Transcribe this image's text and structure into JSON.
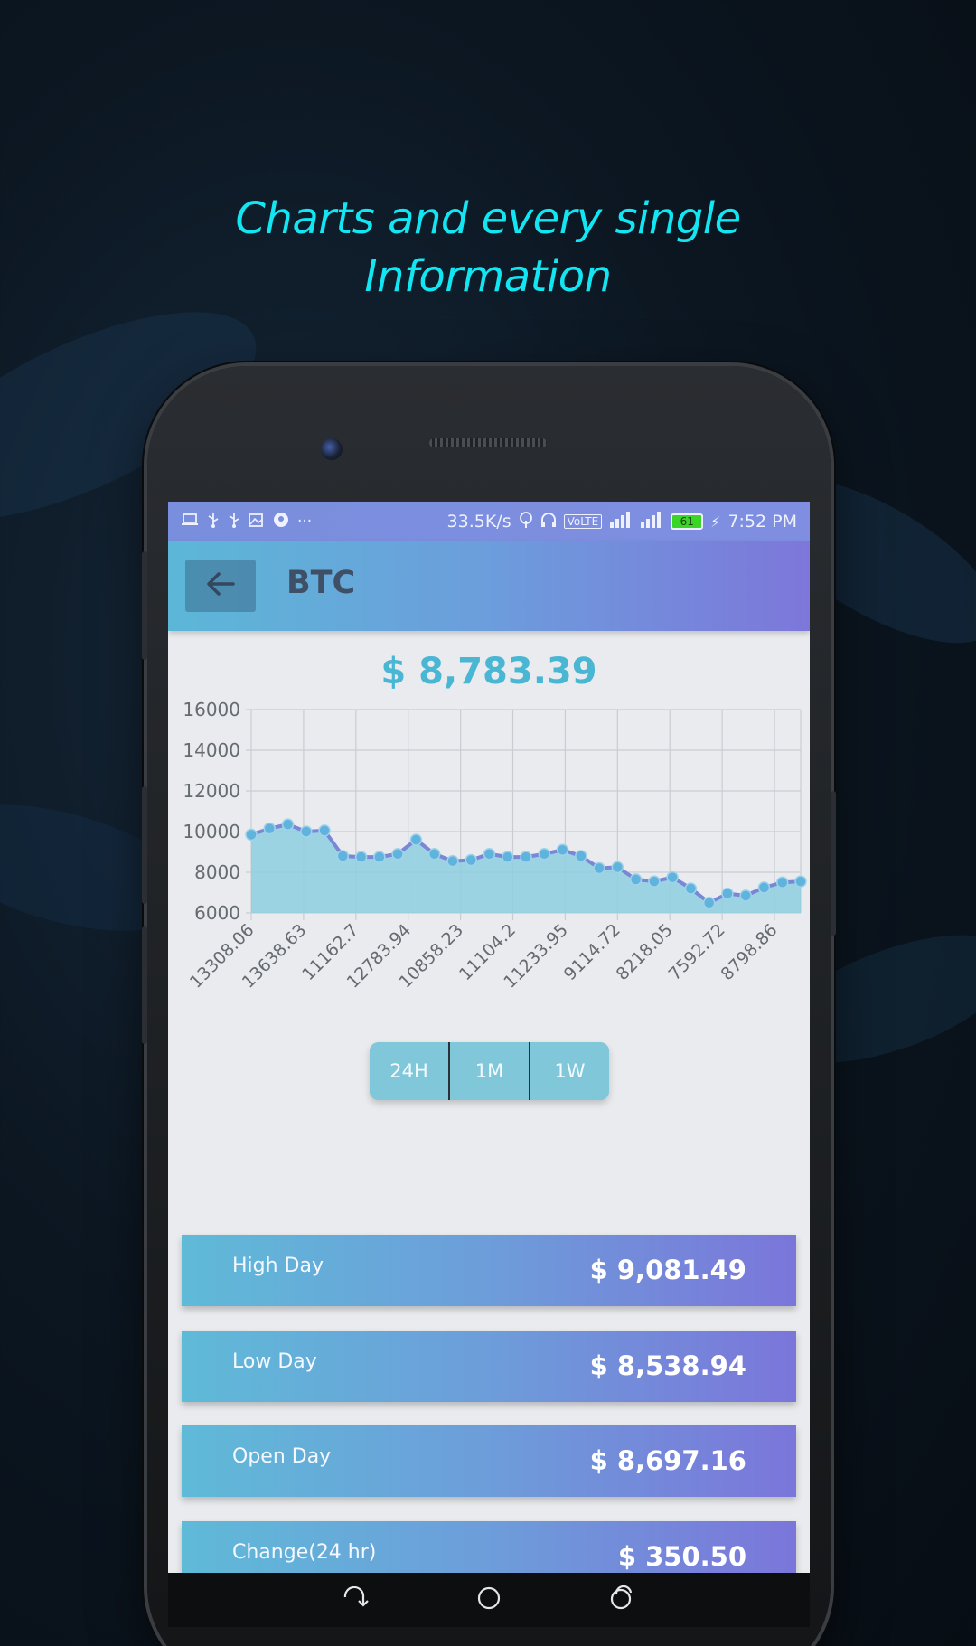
{
  "headline": {
    "line1": "Charts and every single",
    "line2": "Information",
    "color": "#12e6f2"
  },
  "statusbar": {
    "network_speed": "33.5K/s",
    "volte": "VoLTE",
    "battery_level": "61",
    "time": "7:52 PM",
    "left_icons": [
      "laptop-icon",
      "usb-icon",
      "usb-icon",
      "image-icon",
      "location-icon",
      "more-dots-icon"
    ]
  },
  "appbar": {
    "title": "BTC",
    "back_icon": "arrow-left-icon"
  },
  "price": "$ 8,783.39",
  "chart_data": {
    "type": "area",
    "ylim": [
      6000,
      16000
    ],
    "y_ticks": [
      "16000",
      "14000",
      "12000",
      "10000",
      "8000",
      "6000"
    ],
    "x_tick_labels": [
      "13308.06",
      "13638.63",
      "11162.7",
      "12783.94",
      "10858.23",
      "11104.2",
      "11233.95",
      "9114.72",
      "8218.05",
      "7592.72",
      "8798.86"
    ],
    "values": [
      9850,
      10150,
      10350,
      10000,
      10050,
      8800,
      8750,
      8750,
      8900,
      9600,
      8900,
      8550,
      8600,
      8900,
      8750,
      8750,
      8900,
      9100,
      8800,
      8200,
      8250,
      7650,
      7550,
      7750,
      7200,
      6500,
      6950,
      6850,
      7250,
      7500,
      7550
    ],
    "line_color": "#7a86d6",
    "fill_color": "#8ecfe0",
    "point_color": "#5fb3dc",
    "grid": true
  },
  "periods": {
    "items": [
      "24H",
      "1M",
      "1W"
    ]
  },
  "stats": [
    {
      "label": "High Day",
      "value": "$ 9,081.49"
    },
    {
      "label": "Low Day",
      "value": "$ 8,538.94"
    },
    {
      "label": "Open Day",
      "value": "$ 8,697.16"
    },
    {
      "label": "Change(24 hr)",
      "value": "$ 350.50"
    }
  ],
  "navbar": {
    "back_icon": "nav-back-icon",
    "home_icon": "nav-home-icon",
    "recents_icon": "nav-recents-icon"
  }
}
